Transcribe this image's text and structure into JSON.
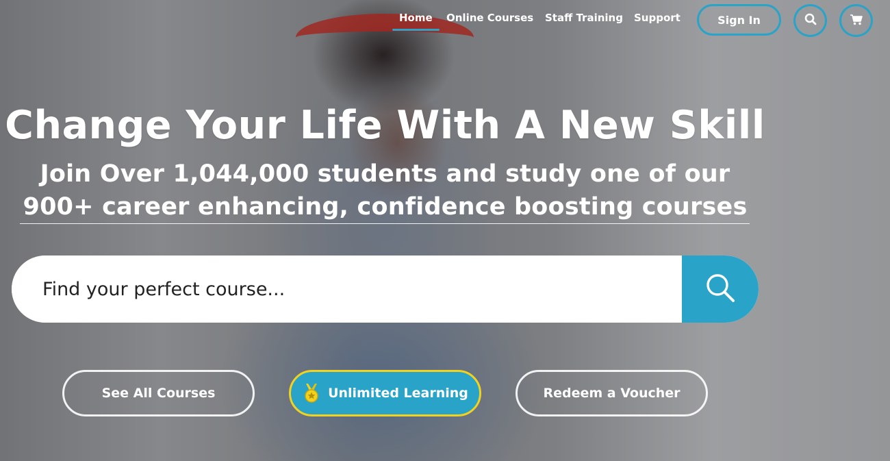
{
  "colors": {
    "accent": "#2aa3c9",
    "gold": "#f2d21e",
    "text": "#ffffff"
  },
  "nav": {
    "links": [
      {
        "label": "Home",
        "active": true
      },
      {
        "label": "Online Courses",
        "active": false
      },
      {
        "label": "Staff Training",
        "active": false
      },
      {
        "label": "Support",
        "active": false
      }
    ],
    "sign_in_label": "Sign In",
    "search_icon": "search-icon",
    "cart_icon": "cart-icon"
  },
  "hero": {
    "headline": "Change Your Life With A New Skill",
    "subline_1": "Join Over 1,044,000 students and study one of our",
    "subline_2": "900+ career enhancing, confidence boosting courses"
  },
  "search": {
    "placeholder": "Find your perfect course...",
    "value": "",
    "submit_icon": "search-icon"
  },
  "cta": {
    "see_all_label": "See All Courses",
    "unlimited_label": "Unlimited Learning",
    "unlimited_icon": "medal-icon",
    "redeem_label": "Redeem a Voucher"
  }
}
